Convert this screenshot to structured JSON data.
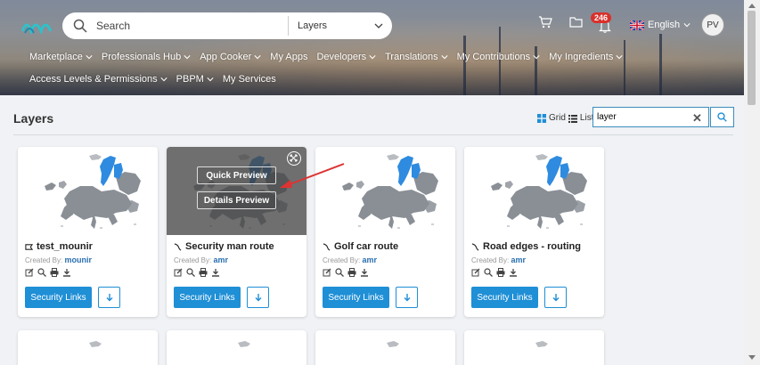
{
  "search": {
    "placeholder": "Search",
    "scope": "Layers"
  },
  "notifications": {
    "count": "246"
  },
  "language": "English",
  "user": {
    "initials": "PV"
  },
  "nav": {
    "row1": [
      "Marketplace",
      "Professionals Hub",
      "App Cooker",
      "My Apps",
      "Developers",
      "Translations",
      "My Contributions",
      "My Ingredients"
    ],
    "row1_dropdown": [
      true,
      true,
      true,
      false,
      true,
      true,
      true,
      true
    ],
    "row2": [
      "Access Levels & Permissions",
      "PBPM",
      "My Services"
    ],
    "row2_dropdown": [
      true,
      true,
      false
    ]
  },
  "page": {
    "title": "Layers"
  },
  "view": {
    "grid_label": "Grid",
    "list_label": "List"
  },
  "filter": {
    "value": "layer"
  },
  "cards": [
    {
      "title": "test_mounir",
      "created_label": "Created By:",
      "author": "mounir",
      "button": "Security Links"
    },
    {
      "title": "Security man route",
      "created_label": "Created By:",
      "author": "amr",
      "button": "Security Links"
    },
    {
      "title": "Golf car route",
      "created_label": "Created By:",
      "author": "amr",
      "button": "Security Links"
    },
    {
      "title": "Road edges - routing",
      "created_label": "Created By:",
      "author": "amr",
      "button": "Security Links"
    }
  ],
  "overlay": {
    "quick_preview": "Quick Preview",
    "details_preview": "Details Preview"
  },
  "colors": {
    "accent": "#1f8fd6",
    "badge": "#d9302b",
    "map_highlight": "#2e8be0",
    "map_base": "#8a8f96"
  }
}
